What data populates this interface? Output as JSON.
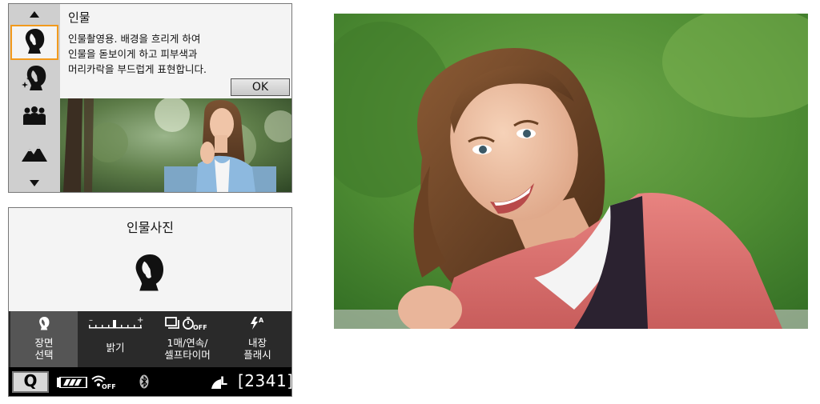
{
  "scene_menu": {
    "title": "인물",
    "description_lines": [
      "인물촬영용. 배경을 흐리게 하여",
      "인물을 돋보이게 하고 피부색과",
      "머리카락을 부드럽게 표현합니다."
    ],
    "ok_label": "OK",
    "items": [
      {
        "icon": "portrait-icon",
        "selected": true
      },
      {
        "icon": "smooth-skin-icon",
        "selected": false
      },
      {
        "icon": "group-photo-icon",
        "selected": false
      },
      {
        "icon": "landscape-icon",
        "selected": false
      }
    ],
    "accent_color": "#f29a1d"
  },
  "q_screen": {
    "title": "인물사진",
    "settings": [
      {
        "icon": "portrait-icon",
        "line1": "장면",
        "line2": "선택",
        "selected": true
      },
      {
        "icon": "brightness-scale-icon",
        "line1": "밝기",
        "line2": "",
        "selected": false
      },
      {
        "icon": "drive-self-timer-icon",
        "line1": "1매/연속/",
        "line2": "셀프타이머",
        "selected": false
      },
      {
        "icon": "flash-auto-icon",
        "line1": "내장",
        "line2": "플래시",
        "selected": false
      }
    ],
    "status": {
      "q_label": "Q",
      "battery_icon": "battery-full-icon",
      "wifi_icon": "wifi-off-icon",
      "bluetooth_icon": "bluetooth-icon",
      "quality": "L",
      "shots_remaining": "[2341]"
    }
  }
}
